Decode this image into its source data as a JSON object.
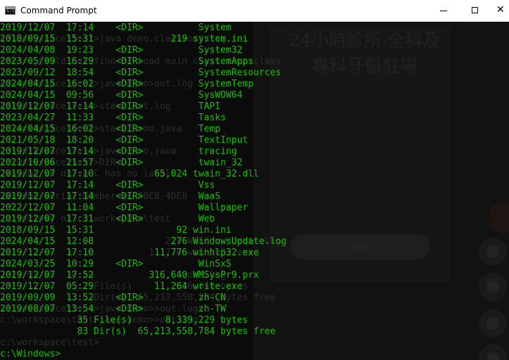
{
  "window": {
    "title": "Command Prompt",
    "controls": {
      "minimize": "—",
      "maximize": "□",
      "close": "✕"
    }
  },
  "background_page": {
    "heading": "24小時診所-全科及專科牙醫駐場",
    "button": "預約"
  },
  "ghost_lines": [
    "c:\\workspace\\test>java demo.class>out.log",
    "Error: Could not find or load main class demo.class",
    "c:\\workspace\\test>java demo>out.log",
    "c:\\workspace\\test>start out.log",
    "c:\\workspace\\test>start demo.java",
    "c:\\workspace\\test>java demo.java",
    "c:\\workspace\\test>DIR",
    " Volume in drive C has no label.",
    " Volume Serial Number is 88C8-4DE0",
    " Directory of c:\\workspace\\test",
    "2024/04/15  12:08             276 WindowsUpdate.log",
    "2019/12/07  17:10          11,776 winhlp32.exe",
    "2024/03/25  10:29               5 out.log",
    "               2 File(s)        316,640 bytes",
    "               3 Dir(s)  65,213,558,784 bytes free",
    "c:\\workspace\\test>java demo>>out.log",
    "c:\\workspace\\test>java demo>>out.log",
    "c:\\workspace\\test>"
  ],
  "listing": [
    {
      "date": "2019/12/07",
      "time": "17:14",
      "size": "<DIR>",
      "name": "System"
    },
    {
      "date": "2018/09/15",
      "time": "15:31",
      "size": "219",
      "name": "system.ini"
    },
    {
      "date": "2024/04/08",
      "time": "19:23",
      "size": "<DIR>",
      "name": "System32"
    },
    {
      "date": "2023/05/09",
      "time": "16:29",
      "size": "<DIR>",
      "name": "SystemApps"
    },
    {
      "date": "2023/09/12",
      "time": "18:54",
      "size": "<DIR>",
      "name": "SystemResources"
    },
    {
      "date": "2024/04/15",
      "time": "16:02",
      "size": "<DIR>",
      "name": "SystemTemp"
    },
    {
      "date": "2024/04/15",
      "time": "09:56",
      "size": "<DIR>",
      "name": "SysWOW64"
    },
    {
      "date": "2019/12/07",
      "time": "17:14",
      "size": "<DIR>",
      "name": "TAPI"
    },
    {
      "date": "2023/04/27",
      "time": "11:33",
      "size": "<DIR>",
      "name": "Tasks"
    },
    {
      "date": "2024/04/15",
      "time": "16:02",
      "size": "<DIR>",
      "name": "Temp"
    },
    {
      "date": "2021/05/18",
      "time": "18:20",
      "size": "<DIR>",
      "name": "TextInput"
    },
    {
      "date": "2019/12/07",
      "time": "17:14",
      "size": "<DIR>",
      "name": "tracing"
    },
    {
      "date": "2021/10/06",
      "time": "21:57",
      "size": "<DIR>",
      "name": "twain_32"
    },
    {
      "date": "2019/12/07",
      "time": "17:10",
      "size": "65,024",
      "name": "twain_32.dll"
    },
    {
      "date": "2019/12/07",
      "time": "17:14",
      "size": "<DIR>",
      "name": "Vss"
    },
    {
      "date": "2019/12/07",
      "time": "17:14",
      "size": "<DIR>",
      "name": "WaaS"
    },
    {
      "date": "2022/12/07",
      "time": "11:04",
      "size": "<DIR>",
      "name": "Wallpaper"
    },
    {
      "date": "2019/12/07",
      "time": "17:31",
      "size": "<DIR>",
      "name": "Web"
    },
    {
      "date": "2018/09/15",
      "time": "15:31",
      "size": "92",
      "name": "win.ini"
    },
    {
      "date": "2024/04/15",
      "time": "12:08",
      "size": "276",
      "name": "WindowsUpdate.log"
    },
    {
      "date": "2019/12/07",
      "time": "17:10",
      "size": "11,776",
      "name": "winhlp32.exe"
    },
    {
      "date": "2024/03/25",
      "time": "10:29",
      "size": "<DIR>",
      "name": "WinSxS"
    },
    {
      "date": "2019/12/07",
      "time": "17:52",
      "size": "316,640",
      "name": "WMSysPr9.prx"
    },
    {
      "date": "2019/12/07",
      "time": "05:29",
      "size": "11,264",
      "name": "write.exe"
    },
    {
      "date": "2019/09/09",
      "time": "13:52",
      "size": "<DIR>",
      "name": "zh-CN"
    },
    {
      "date": "2019/08/07",
      "time": "13:54",
      "size": "<DIR>",
      "name": "zh-TW"
    }
  ],
  "summary": {
    "files": "              35 File(s)      8,339,229 bytes",
    "dirs": "              83 Dir(s)  65,213,558,784 bytes free"
  },
  "prompt": "c:\\Windows>"
}
